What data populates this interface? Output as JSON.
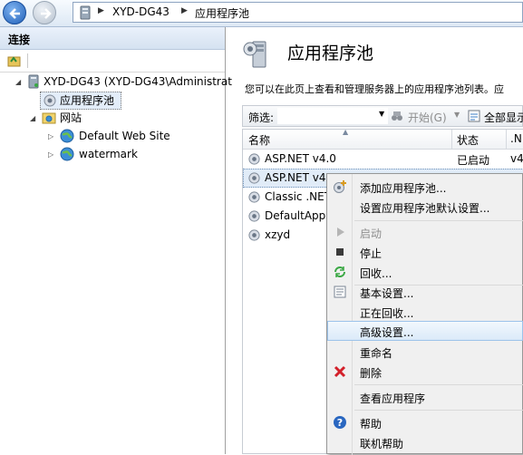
{
  "nav": {
    "back_icon": "back-arrow-icon",
    "forward_icon": "forward-arrow-icon",
    "breadcrumb": [
      "XYD-DG43",
      "应用程序池"
    ]
  },
  "connections": {
    "title": "连接",
    "tree": [
      {
        "label": "XYD-DG43 (XYD-DG43\\Administrat",
        "icon": "server-icon",
        "expanded": true
      },
      {
        "label": "应用程序池",
        "icon": "app-pool-icon",
        "selected": true
      },
      {
        "label": "网站",
        "icon": "sites-folder-icon",
        "expanded": true
      },
      {
        "label": "Default Web Site",
        "icon": "globe-icon"
      },
      {
        "label": "watermark",
        "icon": "globe-icon"
      }
    ]
  },
  "main": {
    "title": "应用程序池",
    "description": "您可以在此页上查看和管理服务器上的应用程序池列表。应",
    "filter": {
      "label": "筛选:",
      "start_button": "开始(G)",
      "showall_button": "全部显示"
    },
    "columns": [
      "名称",
      "状态",
      ".N"
    ],
    "rows": [
      {
        "name": "ASP.NET v4.0",
        "status": "已启动",
        "net": "v4"
      },
      {
        "name": "ASP.NET v4.",
        "status": "",
        "net": ""
      },
      {
        "name": "Classic .NET",
        "status": "",
        "net": ""
      },
      {
        "name": "DefaultAppP",
        "status": "",
        "net": ""
      },
      {
        "name": "xzyd",
        "status": "",
        "net": ""
      }
    ]
  },
  "context_menu": {
    "items": [
      {
        "label": "添加应用程序池...",
        "icon": "add-app-pool-icon"
      },
      {
        "label": "设置应用程序池默认设置...",
        "icon": ""
      },
      {
        "separator": true
      },
      {
        "label": "启动",
        "icon": "play-icon",
        "disabled": true
      },
      {
        "label": "停止",
        "icon": "stop-icon"
      },
      {
        "label": "回收...",
        "icon": "recycle-icon"
      },
      {
        "separator": true
      },
      {
        "label": "基本设置...",
        "icon": "settings-page-icon"
      },
      {
        "label": "正在回收...",
        "icon": ""
      },
      {
        "label": "高级设置...",
        "icon": "",
        "highlighted": true
      },
      {
        "label": "重命名",
        "icon": ""
      },
      {
        "label": "删除",
        "icon": "delete-x-icon"
      },
      {
        "separator": true
      },
      {
        "label": "查看应用程序",
        "icon": ""
      },
      {
        "separator": true
      },
      {
        "label": "帮助",
        "icon": "help-icon"
      },
      {
        "label": "联机帮助",
        "icon": ""
      }
    ]
  },
  "colors": {
    "accent": "#1f5fb8",
    "selection": "#dbeaf9",
    "delete": "#d3202a"
  }
}
